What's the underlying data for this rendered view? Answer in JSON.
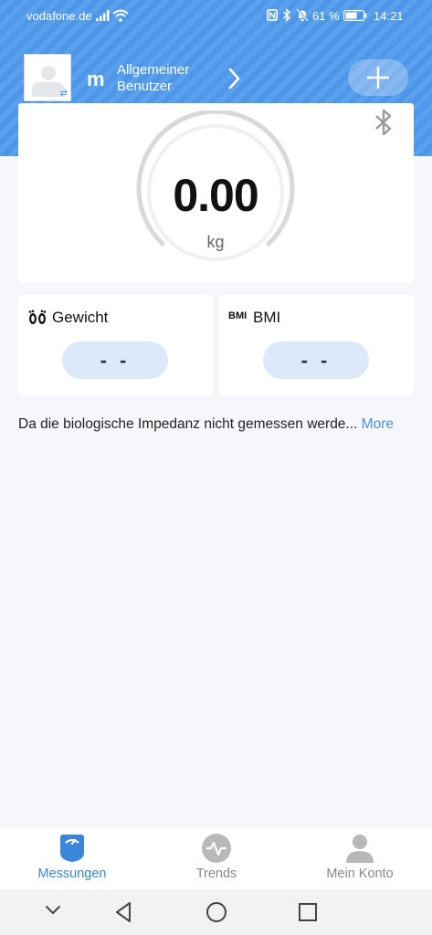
{
  "status_bar": {
    "carrier": "vodafone.de",
    "battery_percent": "61 %",
    "time": "14:21"
  },
  "header": {
    "user_initial": "m",
    "user_name": "Allgemeiner Benutzer",
    "avatar_swap_glyph": "⇄"
  },
  "scale": {
    "weight": "0.00",
    "unit": "kg"
  },
  "metrics": [
    {
      "title": "Gewicht",
      "value": "- -",
      "icon": "footprints-icon"
    },
    {
      "title": "BMI",
      "value": "- -",
      "icon_text": "BMI"
    }
  ],
  "notice": {
    "text": "Da die biologische Impedanz nicht gemessen werde...",
    "more_label": "More"
  },
  "bottom_nav": {
    "items": [
      {
        "label": "Messungen",
        "active": true,
        "icon": "scale-icon"
      },
      {
        "label": "Trends",
        "active": false,
        "icon": "pulse-icon"
      },
      {
        "label": "Mein Konto",
        "active": false,
        "icon": "person-icon"
      }
    ]
  },
  "colors": {
    "header_blue": "#4d96e8",
    "accent": "#3b86d9",
    "pill_bg": "#dde9fb",
    "link": "#4a90e2"
  }
}
